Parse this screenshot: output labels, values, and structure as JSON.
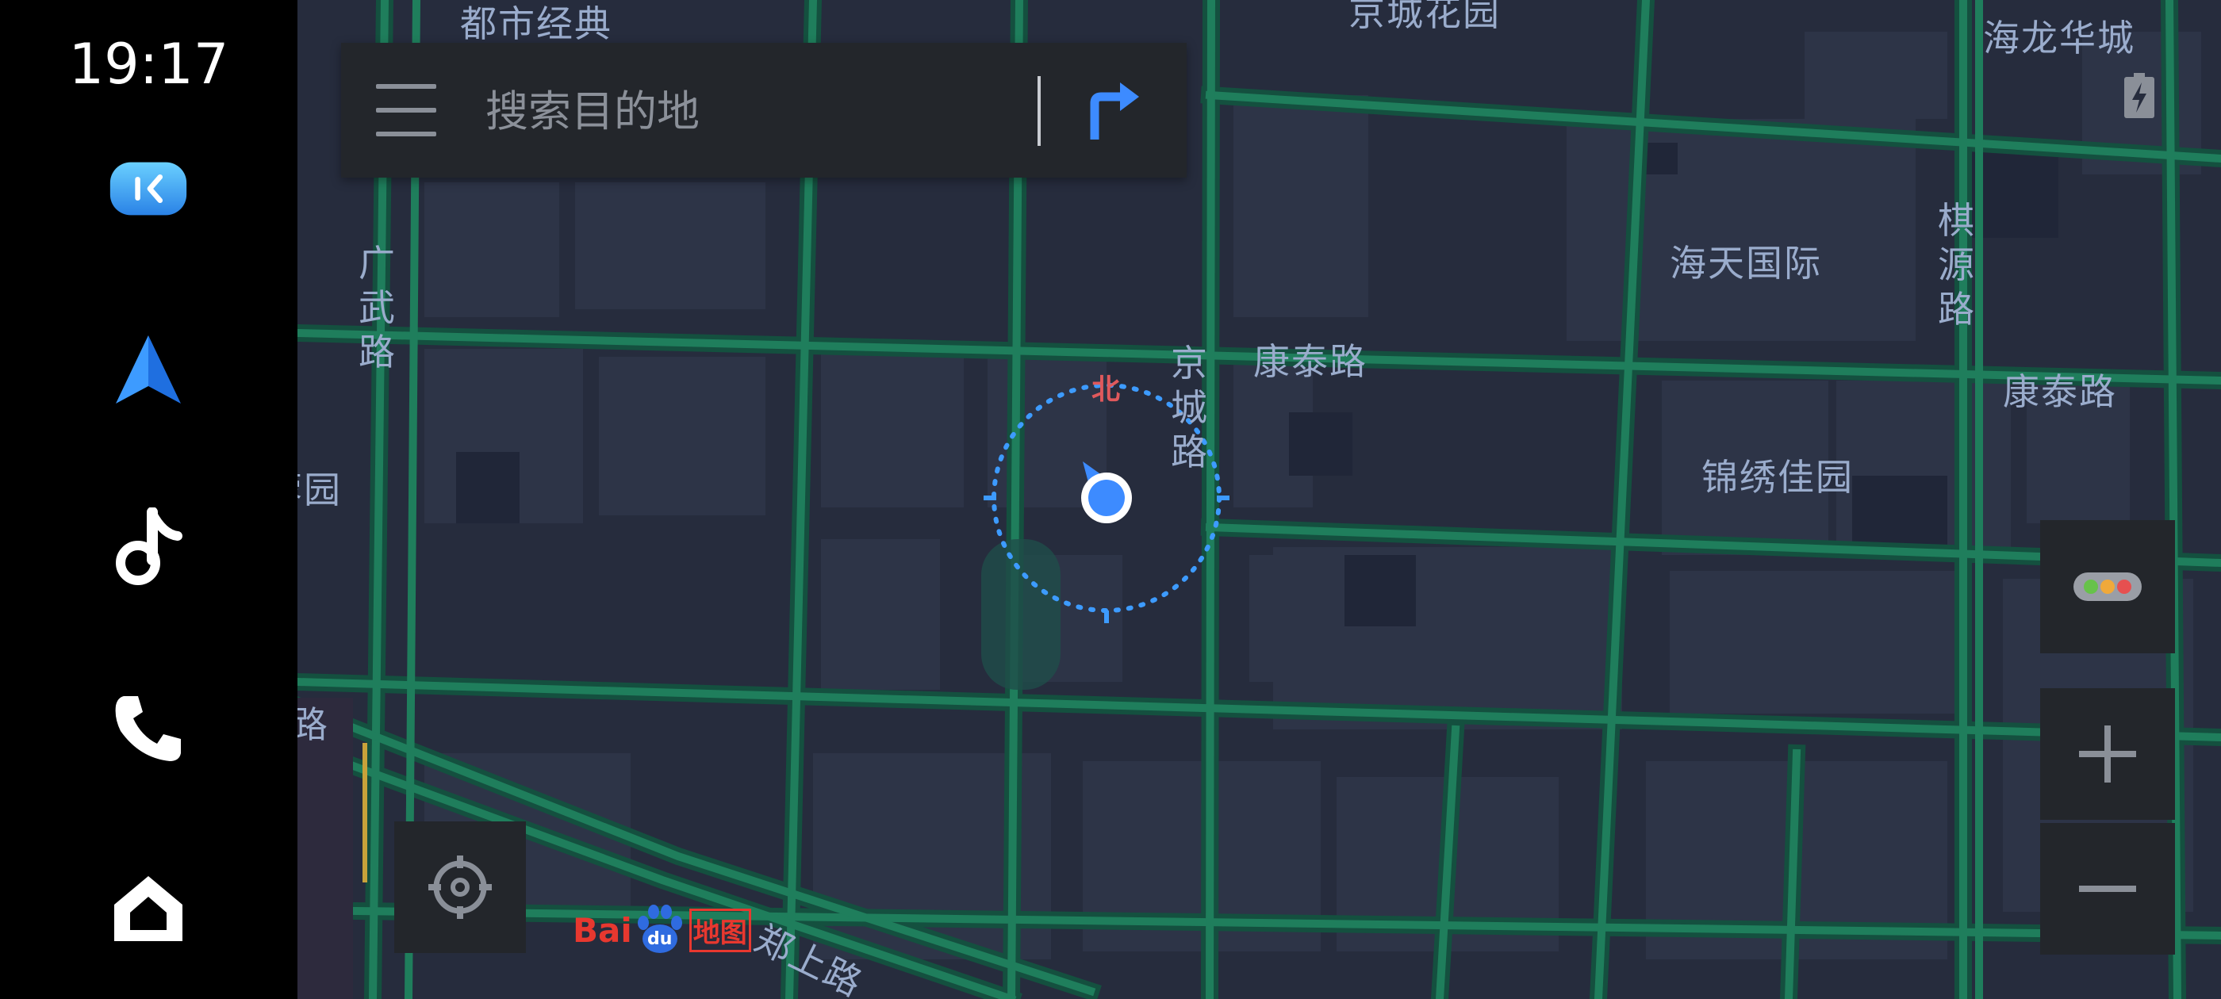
{
  "status": {
    "time": "19:17"
  },
  "sidebar": {
    "items": [
      {
        "name": "carlife-button",
        "icon": "carlife-icon"
      },
      {
        "name": "navigation-button",
        "icon": "navigation-arrow-icon"
      },
      {
        "name": "music-button",
        "icon": "music-note-icon"
      },
      {
        "name": "phone-button",
        "icon": "phone-icon"
      },
      {
        "name": "home-button",
        "icon": "home-icon"
      }
    ]
  },
  "search": {
    "placeholder": "搜索目的地"
  },
  "map": {
    "labels": {
      "dushi_jingdian": "都市经典",
      "jingcheng_huayuan": "京城花园",
      "hailong_huacheng": "海龙华城",
      "guangwu_lu": "广武路",
      "haitian_guoji": "海天国际",
      "qiyuan_lu": "棋源路",
      "jingcheng_lu": "京城路",
      "kangtai_lu_1": "康泰路",
      "kangtai_lu_2": "康泰路",
      "jinxiu_jiayuan": "锦绣佳园",
      "partial_yuan": "蓉园",
      "partial_lu": "路",
      "zhengshang_lu": "郑上路"
    },
    "compass_north": "北"
  },
  "logo": {
    "bai": "Bai",
    "du": "du",
    "ditu": "地图"
  },
  "colors": {
    "map_bg": "#262c3d",
    "road": "#1e7e5e",
    "accent_blue": "#3d8bff",
    "compass_red": "#e0595c"
  }
}
